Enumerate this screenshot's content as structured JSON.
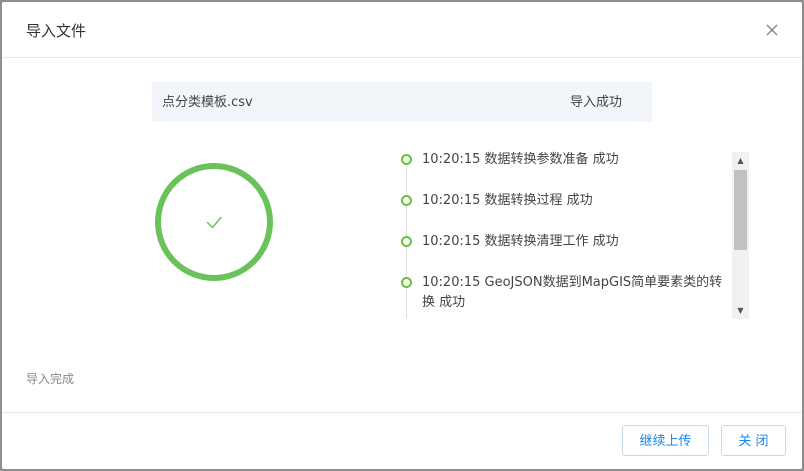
{
  "dialog": {
    "title": "导入文件",
    "close_icon": "close-icon"
  },
  "file": {
    "name": "点分类模板.csv",
    "status": "导入成功"
  },
  "progress": {
    "state": "success",
    "check_icon": "check-icon",
    "percent": 100,
    "color": "#6cc25a"
  },
  "logs": [
    {
      "text": "10:20:15 数据转换参数准备 成功"
    },
    {
      "text": "10:20:15 数据转换过程 成功"
    },
    {
      "text": "10:20:15 数据转换清理工作 成功"
    },
    {
      "text": "10:20:15 GeoJSON数据到MapGIS简单要素类的转换 成功"
    }
  ],
  "status_text": "导入完成",
  "buttons": {
    "continue_label": "继续上传",
    "close_label": "关 闭"
  },
  "colors": {
    "accent": "#1e88e5",
    "success": "#67c23a"
  }
}
